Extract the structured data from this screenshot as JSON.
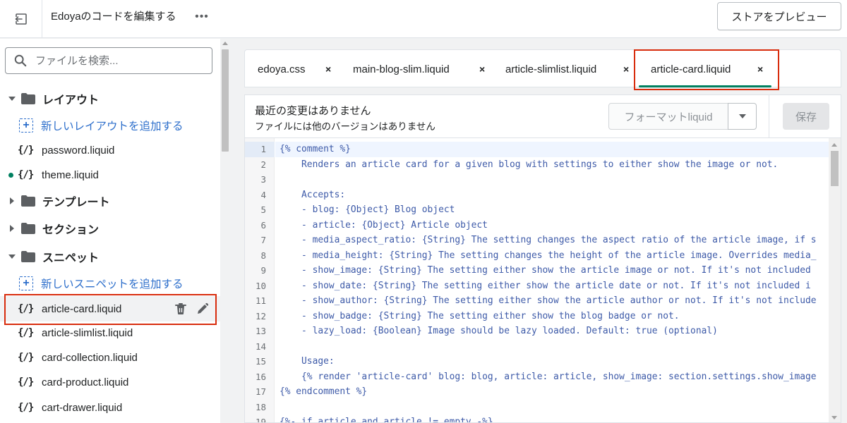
{
  "header": {
    "title": "Edoyaのコードを編集する",
    "more_label": "•••",
    "preview_label": "ストアをプレビュー",
    "exit_icon": "exit-icon"
  },
  "sidebar": {
    "search_placeholder": "ファイルを検索...",
    "folders": [
      {
        "label": "レイアウト",
        "expanded": true
      },
      {
        "label": "テンプレート",
        "expanded": false
      },
      {
        "label": "セクション",
        "expanded": false
      },
      {
        "label": "スニペット",
        "expanded": true
      }
    ],
    "layout_add": "新しいレイアウトを追加する",
    "layout_files": [
      "password.liquid",
      "theme.liquid"
    ],
    "snippet_add": "新しいスニペットを追加する",
    "snippet_files": [
      "article-card.liquid",
      "article-slimlist.liquid",
      "card-collection.liquid",
      "card-product.liquid",
      "cart-drawer.liquid"
    ],
    "file_icon_glyph": "{/}",
    "add_icon_glyph": "+"
  },
  "tabs": [
    {
      "label": "edoya.css",
      "close": "×"
    },
    {
      "label": "main-blog-slim.liquid",
      "close": "×"
    },
    {
      "label": "article-slimlist.liquid",
      "close": "×"
    },
    {
      "label": "article-card.liquid",
      "close": "×",
      "active": true
    }
  ],
  "infobar": {
    "title": "最近の変更はありません",
    "subtitle": "ファイルには他のバージョンはありません",
    "format_label": "フォーマットliquid",
    "save_label": "保存"
  },
  "code": {
    "lines": [
      {
        "n": "1",
        "text": "{% comment %}"
      },
      {
        "n": "2",
        "text": "    Renders an article card for a given blog with settings to either show the image or not."
      },
      {
        "n": "3",
        "text": ""
      },
      {
        "n": "4",
        "text": "    Accepts:"
      },
      {
        "n": "5",
        "text": "    - blog: {Object} Blog object"
      },
      {
        "n": "6",
        "text": "    - article: {Object} Article object"
      },
      {
        "n": "7",
        "text": "    - media_aspect_ratio: {String} The setting changes the aspect ratio of the article image, if s"
      },
      {
        "n": "8",
        "text": "    - media_height: {String} The setting changes the height of the article image. Overrides media_"
      },
      {
        "n": "9",
        "text": "    - show_image: {String} The setting either show the article image or not. If it's not included"
      },
      {
        "n": "10",
        "text": "    - show_date: {String} The setting either show the article date or not. If it's not included i"
      },
      {
        "n": "11",
        "text": "    - show_author: {String} The setting either show the article author or not. If it's not include"
      },
      {
        "n": "12",
        "text": "    - show_badge: {String} The setting either show the blog badge or not."
      },
      {
        "n": "13",
        "text": "    - lazy_load: {Boolean} Image should be lazy loaded. Default: true (optional)"
      },
      {
        "n": "14",
        "text": ""
      },
      {
        "n": "15",
        "text": "    Usage:"
      },
      {
        "n": "16",
        "text": "    {% render 'article-card' blog: blog, article: article, show_image: section.settings.show_image"
      },
      {
        "n": "17",
        "text": "{% endcomment %}"
      },
      {
        "n": "18",
        "text": ""
      },
      {
        "n": "19",
        "text": "{%- if article and article != empty -%}"
      }
    ]
  },
  "colors": {
    "accent": "#008060",
    "link": "#2c6ecb",
    "highlight_border": "#d82c0d",
    "code_text": "#3d5aa8"
  }
}
